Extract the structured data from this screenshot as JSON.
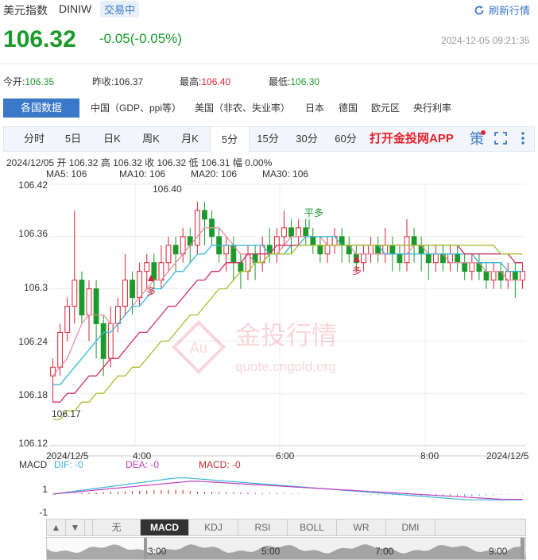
{
  "header": {
    "title": "美元指数",
    "code": "DINIW",
    "status": "交易中",
    "refresh_label": "刷新行情",
    "price": "106.32",
    "change": "-0.05(-0.05%)",
    "datetime": "2024-12-05 09:21:35",
    "colors": {
      "down": "#1a9a2a",
      "up": "#dd2233",
      "accent": "#3a78c9"
    }
  },
  "stats": {
    "open_label": "今开:",
    "open": "106.35",
    "prev_close_label": "昨收:",
    "prev_close": "106.37",
    "high_label": "最高:",
    "high": "106.40",
    "low_label": "最低:",
    "low": "106.30"
  },
  "categories": {
    "active": "各国数据",
    "items": [
      "中国（GDP、ppi等）",
      "美国（非农、失业率）",
      "日本",
      "德国",
      "欧元区",
      "央行利率"
    ]
  },
  "tabs": {
    "items": [
      "分时",
      "5日",
      "日K",
      "周K",
      "月K",
      "5分",
      "15分",
      "30分",
      "60分"
    ],
    "active": "5分",
    "app_link": "打开金投网APP",
    "strategy": "策"
  },
  "ohlc_line": "2024/12/05  开 106.32  高 106.32  收 106.32  低 106.31  幅 0.00%",
  "ma_legend": [
    {
      "label": "MA5: 106",
      "color": "#e48fa0"
    },
    {
      "label": "MA10: 106",
      "color": "#38b8d8"
    },
    {
      "label": "MA20: 106",
      "color": "#d03060"
    },
    {
      "label": "MA30: 106",
      "color": "#a4c030"
    }
  ],
  "chart_data": {
    "type": "candlestick",
    "y_ticks": [
      "106.42",
      "106.36",
      "106.3",
      "106.24",
      "106.18",
      "106.12"
    ],
    "ylim": [
      106.12,
      106.42
    ],
    "x_ticks": [
      "2024/12/5",
      "4:00",
      "6:00",
      "8:00",
      "2024/12/5"
    ],
    "annotations": [
      {
        "text": "106.40",
        "kind": "high"
      },
      {
        "text": "106.17",
        "kind": "low"
      },
      {
        "text": "平多",
        "color": "#1a9a2a"
      },
      {
        "text": "多",
        "color": "#d23"
      },
      {
        "text": "多",
        "color": "#d23"
      }
    ],
    "watermark": {
      "brand": "金投行情",
      "url": "quote.cngold.org",
      "logo": "Au"
    },
    "candles": [
      [
        106.2,
        106.21,
        106.17,
        106.22
      ],
      [
        106.21,
        106.25,
        106.2,
        106.26
      ],
      [
        106.25,
        106.28,
        106.24,
        106.29
      ],
      [
        106.28,
        106.31,
        106.26,
        106.39
      ],
      [
        106.31,
        106.27,
        106.26,
        106.32
      ],
      [
        106.27,
        106.3,
        106.24,
        106.31
      ],
      [
        106.3,
        106.26,
        106.22,
        106.31
      ],
      [
        106.26,
        106.22,
        106.2,
        106.27
      ],
      [
        106.22,
        106.26,
        106.21,
        106.28
      ],
      [
        106.26,
        106.28,
        106.25,
        106.29
      ],
      [
        106.28,
        106.31,
        106.27,
        106.34
      ],
      [
        106.31,
        106.29,
        106.27,
        106.32
      ],
      [
        106.29,
        106.32,
        106.28,
        106.33
      ],
      [
        106.32,
        106.33,
        106.3,
        106.34
      ],
      [
        106.33,
        106.31,
        106.3,
        106.34
      ],
      [
        106.31,
        106.33,
        106.3,
        106.35
      ],
      [
        106.33,
        106.35,
        106.32,
        106.36
      ],
      [
        106.35,
        106.34,
        106.32,
        106.36
      ],
      [
        106.34,
        106.36,
        106.33,
        106.37
      ],
      [
        106.36,
        106.35,
        106.33,
        106.37
      ],
      [
        106.35,
        106.39,
        106.34,
        106.4
      ],
      [
        106.39,
        106.38,
        106.35,
        106.4
      ],
      [
        106.38,
        106.36,
        106.35,
        106.39
      ],
      [
        106.36,
        106.34,
        106.33,
        106.37
      ],
      [
        106.34,
        106.35,
        106.32,
        106.36
      ],
      [
        106.35,
        106.33,
        106.31,
        106.36
      ],
      [
        106.33,
        106.32,
        106.3,
        106.34
      ],
      [
        106.32,
        106.34,
        106.31,
        106.35
      ],
      [
        106.34,
        106.33,
        106.31,
        106.35
      ],
      [
        106.33,
        106.35,
        106.32,
        106.36
      ],
      [
        106.35,
        106.34,
        106.33,
        106.37
      ],
      [
        106.34,
        106.36,
        106.33,
        106.37
      ],
      [
        106.36,
        106.37,
        106.35,
        106.39
      ],
      [
        106.37,
        106.36,
        106.34,
        106.38
      ],
      [
        106.36,
        106.37,
        106.35,
        106.38
      ],
      [
        106.37,
        106.36,
        106.35,
        106.38
      ],
      [
        106.36,
        106.35,
        106.34,
        106.37
      ],
      [
        106.35,
        106.34,
        106.33,
        106.36
      ],
      [
        106.34,
        106.35,
        106.33,
        106.36
      ],
      [
        106.35,
        106.36,
        106.34,
        106.37
      ],
      [
        106.36,
        106.35,
        106.33,
        106.37
      ],
      [
        106.35,
        106.34,
        106.33,
        106.36
      ],
      [
        106.34,
        106.33,
        106.32,
        106.35
      ],
      [
        106.33,
        106.34,
        106.32,
        106.35
      ],
      [
        106.34,
        106.35,
        106.33,
        106.36
      ],
      [
        106.35,
        106.34,
        106.33,
        106.36
      ],
      [
        106.34,
        106.35,
        106.33,
        106.37
      ],
      [
        106.35,
        106.34,
        106.32,
        106.36
      ],
      [
        106.34,
        106.33,
        106.32,
        106.35
      ],
      [
        106.33,
        106.36,
        106.32,
        106.38
      ],
      [
        106.36,
        106.35,
        106.33,
        106.37
      ],
      [
        106.35,
        106.34,
        106.32,
        106.36
      ],
      [
        106.34,
        106.33,
        106.31,
        106.35
      ],
      [
        106.33,
        106.34,
        106.32,
        106.35
      ],
      [
        106.34,
        106.33,
        106.32,
        106.35
      ],
      [
        106.33,
        106.34,
        106.32,
        106.35
      ],
      [
        106.34,
        106.33,
        106.32,
        106.35
      ],
      [
        106.33,
        106.32,
        106.31,
        106.34
      ],
      [
        106.32,
        106.33,
        106.31,
        106.34
      ],
      [
        106.33,
        106.32,
        106.31,
        106.34
      ],
      [
        106.32,
        106.31,
        106.3,
        106.33
      ],
      [
        106.31,
        106.32,
        106.3,
        106.33
      ],
      [
        106.32,
        106.31,
        106.3,
        106.33
      ],
      [
        106.31,
        106.32,
        106.3,
        106.33
      ],
      [
        106.32,
        106.31,
        106.29,
        106.33
      ],
      [
        106.31,
        106.32,
        106.3,
        106.33
      ]
    ],
    "ma5": [
      106.2,
      106.21,
      106.22,
      106.24,
      106.26,
      106.27,
      106.27,
      106.27,
      106.26,
      106.26,
      106.27,
      106.28,
      106.29,
      106.3,
      106.31,
      106.31,
      106.32,
      106.33,
      106.34,
      106.35,
      106.36,
      106.37,
      106.37,
      106.37,
      106.36,
      106.35,
      106.34,
      106.34,
      106.33,
      106.33,
      106.34,
      106.34,
      106.35,
      106.36,
      106.36,
      106.36,
      106.36,
      106.36,
      106.35,
      106.35,
      106.35,
      106.35,
      106.34,
      106.34,
      106.34,
      106.34,
      106.34,
      106.34,
      106.34,
      106.34,
      106.35,
      106.35,
      106.34,
      106.34,
      106.34,
      106.33,
      106.33,
      106.33,
      106.33,
      106.33,
      106.32,
      106.32,
      106.32,
      106.31,
      106.31,
      106.31
    ],
    "ma10": [
      106.19,
      106.19,
      106.2,
      106.21,
      106.22,
      106.23,
      106.24,
      106.25,
      106.25,
      106.26,
      106.27,
      106.28,
      106.28,
      106.29,
      106.3,
      106.3,
      106.31,
      106.32,
      106.32,
      106.33,
      106.34,
      106.34,
      106.35,
      106.35,
      106.35,
      106.35,
      106.35,
      106.35,
      106.35,
      106.35,
      106.34,
      106.34,
      106.34,
      106.35,
      106.35,
      106.36,
      106.36,
      106.36,
      106.36,
      106.36,
      106.35,
      106.35,
      106.35,
      106.35,
      106.35,
      106.35,
      106.34,
      106.34,
      106.34,
      106.34,
      106.34,
      106.34,
      106.34,
      106.34,
      106.34,
      106.34,
      106.34,
      106.34,
      106.34,
      106.33,
      106.33,
      106.33,
      106.33,
      106.32,
      106.32,
      106.32
    ],
    "ma20": [
      106.17,
      106.17,
      106.18,
      106.18,
      106.19,
      106.2,
      106.2,
      106.21,
      106.22,
      106.22,
      106.23,
      106.24,
      106.25,
      106.25,
      106.26,
      106.27,
      106.28,
      106.28,
      106.29,
      106.3,
      106.31,
      106.31,
      106.32,
      106.32,
      106.33,
      106.33,
      106.33,
      106.34,
      106.34,
      106.34,
      106.34,
      106.35,
      106.35,
      106.35,
      106.35,
      106.35,
      106.35,
      106.35,
      106.35,
      106.35,
      106.35,
      106.35,
      106.35,
      106.35,
      106.35,
      106.35,
      106.35,
      106.35,
      106.35,
      106.35,
      106.35,
      106.35,
      106.35,
      106.35,
      106.35,
      106.35,
      106.35,
      106.34,
      106.34,
      106.34,
      106.34,
      106.34,
      106.34,
      106.34,
      106.33,
      106.33
    ],
    "ma30": [
      106.15,
      106.15,
      106.16,
      106.16,
      106.17,
      106.17,
      106.18,
      106.18,
      106.19,
      106.2,
      106.2,
      106.21,
      106.21,
      106.22,
      106.23,
      106.24,
      106.24,
      106.25,
      106.26,
      106.27,
      106.27,
      106.28,
      106.29,
      106.3,
      106.3,
      106.31,
      106.32,
      106.32,
      106.33,
      106.33,
      106.34,
      106.34,
      106.34,
      106.34,
      106.35,
      106.35,
      106.35,
      106.35,
      106.35,
      106.35,
      106.35,
      106.35,
      106.35,
      106.35,
      106.35,
      106.35,
      106.35,
      106.35,
      106.35,
      106.35,
      106.35,
      106.35,
      106.35,
      106.35,
      106.35,
      106.35,
      106.35,
      106.35,
      106.35,
      106.35,
      106.35,
      106.35,
      106.34,
      106.34,
      106.34,
      106.34
    ]
  },
  "macd": {
    "label": "MACD",
    "dif": "DIF: -0",
    "dea": "DEA: -0",
    "macd": "MACD: -0",
    "y_ticks": [
      "1",
      "-1"
    ],
    "colors": {
      "dif": "#38b8d8",
      "dea": "#c040c0",
      "macd": "#c03030"
    }
  },
  "indicators": {
    "up": "▲",
    "down": "▼",
    "items": [
      "无",
      "MACD",
      "KDJ",
      "RSI",
      "BOLL",
      "WR",
      "DMI"
    ],
    "active": "MACD"
  },
  "navigator": {
    "labels": [
      "3:00",
      "5:00",
      "7:00",
      "9:00"
    ]
  }
}
